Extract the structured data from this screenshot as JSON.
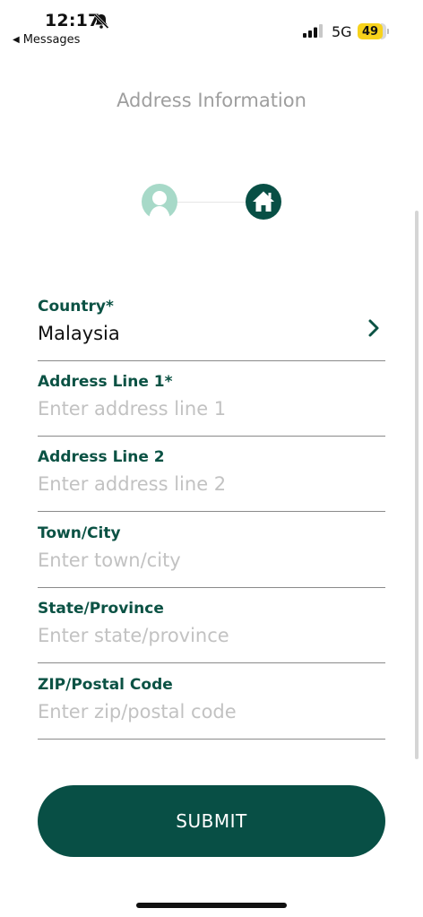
{
  "status_bar": {
    "time": "12:17",
    "back_label": "Messages",
    "network": "5G",
    "battery": "49"
  },
  "page": {
    "title": "Address Information"
  },
  "stepper": {
    "steps": [
      {
        "icon": "user-icon",
        "state": "completed"
      },
      {
        "icon": "home-icon",
        "state": "active"
      }
    ]
  },
  "form": {
    "country": {
      "label": "Country*",
      "value": "Malaysia"
    },
    "address_line_1": {
      "label": "Address Line 1*",
      "placeholder": "Enter address line 1"
    },
    "address_line_2": {
      "label": "Address Line 2",
      "placeholder": "Enter address line 2"
    },
    "town_city": {
      "label": "Town/City",
      "placeholder": "Enter town/city"
    },
    "state_province": {
      "label": "State/Province",
      "placeholder": "Enter state/province"
    },
    "zip_postal": {
      "label": "ZIP/Postal Code",
      "placeholder": "Enter zip/postal code"
    }
  },
  "submit_label": "SUBMIT",
  "colors": {
    "primary": "#084f45",
    "label": "#0b5244",
    "step_completed": "#a7d9c8",
    "placeholder": "#c2c2c2",
    "title": "#9e9e9e"
  }
}
